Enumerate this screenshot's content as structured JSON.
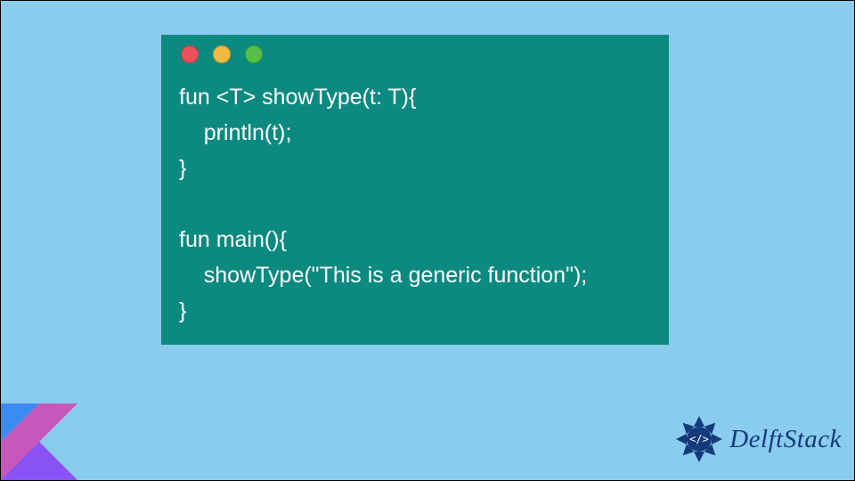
{
  "codeWindow": {
    "trafficLights": [
      "red",
      "yellow",
      "green"
    ],
    "code": "fun <T> showType(t: T){\n    println(t);\n}\n\nfun main(){\n    showType(\"This is a generic function\");\n}"
  },
  "brand": {
    "name": "DelftStack"
  }
}
